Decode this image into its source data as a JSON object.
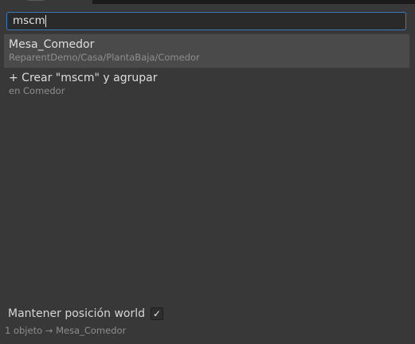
{
  "search": {
    "value": "mscm"
  },
  "results": [
    {
      "title": "Mesa_Comedor",
      "path": "ReparentDemo/Casa/PlantaBaja/Comedor"
    },
    {
      "title": "+ Crear \"mscm\" y agrupar",
      "path": "en Comedor"
    }
  ],
  "options": {
    "keep_world_label": "Mantener posición world",
    "keep_world_checked": true,
    "check_glyph": "✓"
  },
  "status": {
    "text": "1 objeto → Mesa_Comedor"
  },
  "colors": {
    "background": "#383838",
    "focus_border": "#3a79bb",
    "selected_row": "#4a4a4a"
  }
}
